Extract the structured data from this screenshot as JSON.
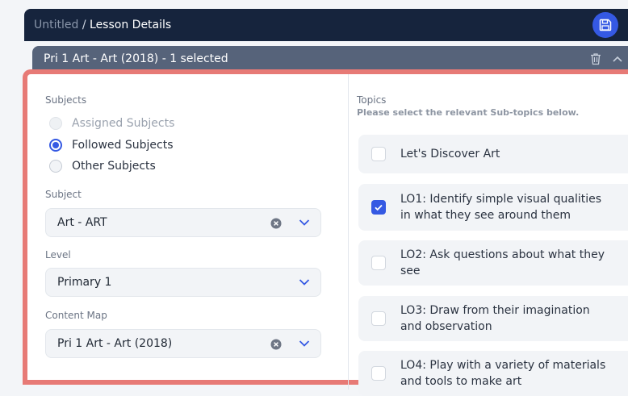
{
  "header": {
    "crumb_root": "Untitled",
    "crumb_sep": " / ",
    "crumb_current": "Lesson Details",
    "save_icon": "save-icon"
  },
  "subheader": {
    "title": "Pri 1 Art - Art (2018) - 1 selected",
    "delete_icon": "trash-icon",
    "collapse_icon": "chevron-up-icon"
  },
  "form": {
    "subjects_label": "Subjects",
    "radios": [
      {
        "label": "Assigned Subjects",
        "state": "disabled"
      },
      {
        "label": "Followed Subjects",
        "state": "selected"
      },
      {
        "label": "Other Subjects",
        "state": "unselected"
      }
    ],
    "subject_label": "Subject",
    "subject_value": "Art - ART",
    "level_label": "Level",
    "level_value": "Primary 1",
    "content_map_label": "Content Map",
    "content_map_value": "Pri 1 Art - Art  (2018)"
  },
  "topics": {
    "label": "Topics",
    "hint": "Please select the relevant Sub-topics below.",
    "items": [
      {
        "text": "Let's Discover Art",
        "checked": false
      },
      {
        "text": "LO1: Identify simple visual qualities in what they see around them",
        "checked": true
      },
      {
        "text": "LO2: Ask questions about what they see",
        "checked": false
      },
      {
        "text": "LO3: Draw from their imagination and observation",
        "checked": false
      },
      {
        "text": "LO4: Play with a variety of materials and tools to make art",
        "checked": false
      }
    ]
  },
  "colors": {
    "accent": "#3559e3",
    "panel_border": "#e77a76",
    "header_bg": "#16243d",
    "subheader_bg": "#56637a"
  }
}
